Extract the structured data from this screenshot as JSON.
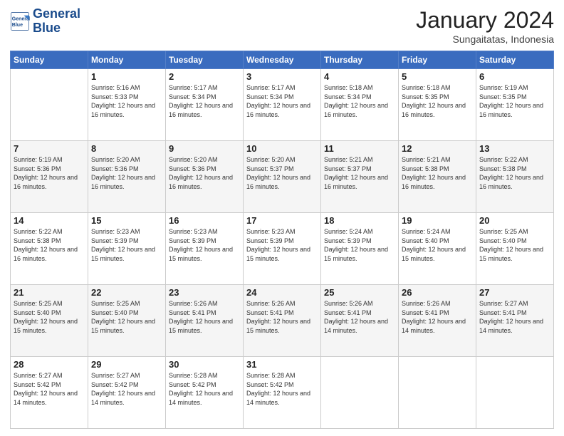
{
  "logo": {
    "line1": "General",
    "line2": "Blue"
  },
  "title": "January 2024",
  "subtitle": "Sungaitatas, Indonesia",
  "days_of_week": [
    "Sunday",
    "Monday",
    "Tuesday",
    "Wednesday",
    "Thursday",
    "Friday",
    "Saturday"
  ],
  "weeks": [
    [
      {
        "day": "",
        "info": ""
      },
      {
        "day": "1",
        "sunrise": "5:16 AM",
        "sunset": "5:33 PM",
        "daylight": "12 hours and 16 minutes."
      },
      {
        "day": "2",
        "sunrise": "5:17 AM",
        "sunset": "5:34 PM",
        "daylight": "12 hours and 16 minutes."
      },
      {
        "day": "3",
        "sunrise": "5:17 AM",
        "sunset": "5:34 PM",
        "daylight": "12 hours and 16 minutes."
      },
      {
        "day": "4",
        "sunrise": "5:18 AM",
        "sunset": "5:34 PM",
        "daylight": "12 hours and 16 minutes."
      },
      {
        "day": "5",
        "sunrise": "5:18 AM",
        "sunset": "5:35 PM",
        "daylight": "12 hours and 16 minutes."
      },
      {
        "day": "6",
        "sunrise": "5:19 AM",
        "sunset": "5:35 PM",
        "daylight": "12 hours and 16 minutes."
      }
    ],
    [
      {
        "day": "7",
        "sunrise": "5:19 AM",
        "sunset": "5:36 PM",
        "daylight": "12 hours and 16 minutes."
      },
      {
        "day": "8",
        "sunrise": "5:20 AM",
        "sunset": "5:36 PM",
        "daylight": "12 hours and 16 minutes."
      },
      {
        "day": "9",
        "sunrise": "5:20 AM",
        "sunset": "5:36 PM",
        "daylight": "12 hours and 16 minutes."
      },
      {
        "day": "10",
        "sunrise": "5:20 AM",
        "sunset": "5:37 PM",
        "daylight": "12 hours and 16 minutes."
      },
      {
        "day": "11",
        "sunrise": "5:21 AM",
        "sunset": "5:37 PM",
        "daylight": "12 hours and 16 minutes."
      },
      {
        "day": "12",
        "sunrise": "5:21 AM",
        "sunset": "5:38 PM",
        "daylight": "12 hours and 16 minutes."
      },
      {
        "day": "13",
        "sunrise": "5:22 AM",
        "sunset": "5:38 PM",
        "daylight": "12 hours and 16 minutes."
      }
    ],
    [
      {
        "day": "14",
        "sunrise": "5:22 AM",
        "sunset": "5:38 PM",
        "daylight": "12 hours and 16 minutes."
      },
      {
        "day": "15",
        "sunrise": "5:23 AM",
        "sunset": "5:39 PM",
        "daylight": "12 hours and 15 minutes."
      },
      {
        "day": "16",
        "sunrise": "5:23 AM",
        "sunset": "5:39 PM",
        "daylight": "12 hours and 15 minutes."
      },
      {
        "day": "17",
        "sunrise": "5:23 AM",
        "sunset": "5:39 PM",
        "daylight": "12 hours and 15 minutes."
      },
      {
        "day": "18",
        "sunrise": "5:24 AM",
        "sunset": "5:39 PM",
        "daylight": "12 hours and 15 minutes."
      },
      {
        "day": "19",
        "sunrise": "5:24 AM",
        "sunset": "5:40 PM",
        "daylight": "12 hours and 15 minutes."
      },
      {
        "day": "20",
        "sunrise": "5:25 AM",
        "sunset": "5:40 PM",
        "daylight": "12 hours and 15 minutes."
      }
    ],
    [
      {
        "day": "21",
        "sunrise": "5:25 AM",
        "sunset": "5:40 PM",
        "daylight": "12 hours and 15 minutes."
      },
      {
        "day": "22",
        "sunrise": "5:25 AM",
        "sunset": "5:40 PM",
        "daylight": "12 hours and 15 minutes."
      },
      {
        "day": "23",
        "sunrise": "5:26 AM",
        "sunset": "5:41 PM",
        "daylight": "12 hours and 15 minutes."
      },
      {
        "day": "24",
        "sunrise": "5:26 AM",
        "sunset": "5:41 PM",
        "daylight": "12 hours and 15 minutes."
      },
      {
        "day": "25",
        "sunrise": "5:26 AM",
        "sunset": "5:41 PM",
        "daylight": "12 hours and 14 minutes."
      },
      {
        "day": "26",
        "sunrise": "5:26 AM",
        "sunset": "5:41 PM",
        "daylight": "12 hours and 14 minutes."
      },
      {
        "day": "27",
        "sunrise": "5:27 AM",
        "sunset": "5:41 PM",
        "daylight": "12 hours and 14 minutes."
      }
    ],
    [
      {
        "day": "28",
        "sunrise": "5:27 AM",
        "sunset": "5:42 PM",
        "daylight": "12 hours and 14 minutes."
      },
      {
        "day": "29",
        "sunrise": "5:27 AM",
        "sunset": "5:42 PM",
        "daylight": "12 hours and 14 minutes."
      },
      {
        "day": "30",
        "sunrise": "5:28 AM",
        "sunset": "5:42 PM",
        "daylight": "12 hours and 14 minutes."
      },
      {
        "day": "31",
        "sunrise": "5:28 AM",
        "sunset": "5:42 PM",
        "daylight": "12 hours and 14 minutes."
      },
      {
        "day": "",
        "info": ""
      },
      {
        "day": "",
        "info": ""
      },
      {
        "day": "",
        "info": ""
      }
    ]
  ],
  "labels": {
    "sunrise_prefix": "Sunrise: ",
    "sunset_prefix": "Sunset: ",
    "daylight_prefix": "Daylight: "
  }
}
